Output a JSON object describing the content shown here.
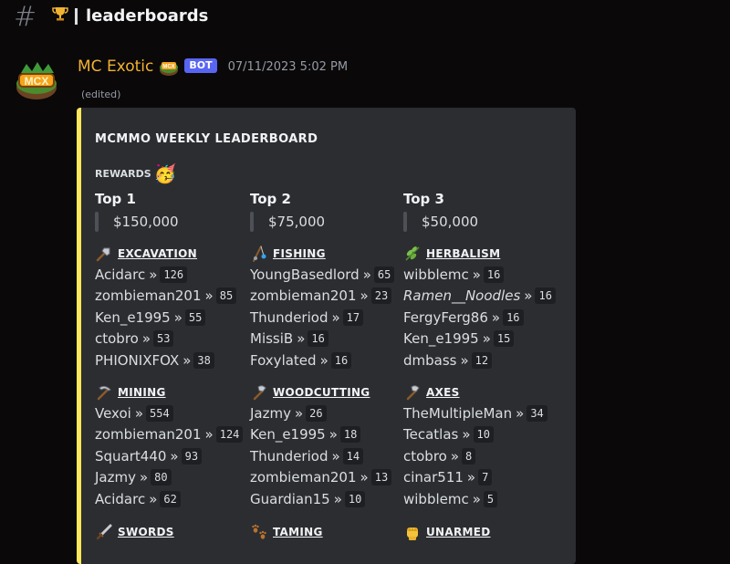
{
  "channel": {
    "icon": "trophy-icon",
    "name": "leaderboards"
  },
  "message": {
    "author": "MC Exotic",
    "bot_tag": "BOT",
    "timestamp": "07/11/2023 5:02 PM",
    "edited": "(edited)"
  },
  "embed": {
    "accent_color": "#fee75c",
    "title": "MCMMO WEEKLY LEADERBOARD",
    "rewards_label": "REWARDS",
    "tiers": [
      {
        "label": "Top 1",
        "prize": "$150,000"
      },
      {
        "label": "Top 2",
        "prize": "$75,000"
      },
      {
        "label": "Top 3",
        "prize": "$50,000"
      }
    ],
    "skills": [
      {
        "name": "EXCAVATION",
        "icon": "shovel-icon",
        "entries": [
          {
            "name": "Acidarc",
            "score": "126"
          },
          {
            "name": "zombieman201",
            "score": "85"
          },
          {
            "name": "Ken_e1995",
            "score": "55"
          },
          {
            "name": "ctobro",
            "score": "53"
          },
          {
            "name": "PHIONIXFOX",
            "score": "38"
          }
        ]
      },
      {
        "name": "FISHING",
        "icon": "fishing-rod-icon",
        "entries": [
          {
            "name": "YoungBasedlord",
            "score": "65"
          },
          {
            "name": "zombieman201",
            "score": "23"
          },
          {
            "name": "Thunderiod",
            "score": "17"
          },
          {
            "name": "MissiB",
            "score": "16"
          },
          {
            "name": "Foxylated",
            "score": "16"
          }
        ]
      },
      {
        "name": "HERBALISM",
        "icon": "herb-icon",
        "entries": [
          {
            "name": "wibblemc",
            "score": "16"
          },
          {
            "name": "Ramen__Noodles",
            "score": "16"
          },
          {
            "name": "FergyFerg86",
            "score": "16"
          },
          {
            "name": "Ken_e1995",
            "score": "15"
          },
          {
            "name": "dmbass",
            "score": "12"
          }
        ]
      },
      {
        "name": "MINING",
        "icon": "pickaxe-icon",
        "entries": [
          {
            "name": "Vexoi",
            "score": "554"
          },
          {
            "name": "zombieman201",
            "score": "124"
          },
          {
            "name": "Squart440",
            "score": "93"
          },
          {
            "name": "Jazmy",
            "score": "80"
          },
          {
            "name": "Acidarc",
            "score": "62"
          }
        ]
      },
      {
        "name": "WOODCUTTING",
        "icon": "axe-icon",
        "entries": [
          {
            "name": "Jazmy",
            "score": "26"
          },
          {
            "name": "Ken_e1995",
            "score": "18"
          },
          {
            "name": "Thunderiod",
            "score": "14"
          },
          {
            "name": "zombieman201",
            "score": "13"
          },
          {
            "name": "Guardian15",
            "score": "10"
          }
        ]
      },
      {
        "name": "AXES",
        "icon": "axe-icon",
        "entries": [
          {
            "name": "TheMultipleMan",
            "score": "34"
          },
          {
            "name": "Tecatlas",
            "score": "10"
          },
          {
            "name": "ctobro",
            "score": "8"
          },
          {
            "name": "cinar511",
            "score": "7"
          },
          {
            "name": "wibblemc",
            "score": "5"
          }
        ]
      },
      {
        "name": "SWORDS",
        "icon": "sword-icon",
        "entries": []
      },
      {
        "name": "TAMING",
        "icon": "paw-prints-icon",
        "entries": []
      },
      {
        "name": "UNARMED",
        "icon": "fist-icon",
        "entries": []
      }
    ]
  }
}
